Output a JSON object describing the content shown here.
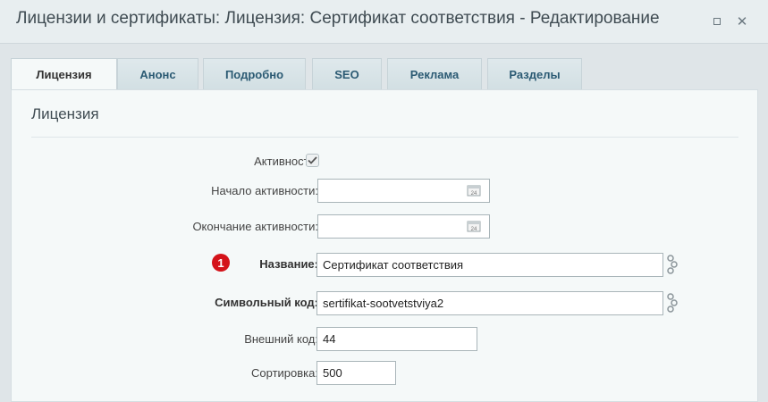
{
  "window": {
    "title": "Лицензии и сертификаты: Лицензия: Сертификат соответствия - Редактирование",
    "minimize_icon": "minimize-icon",
    "close_icon": "close-icon"
  },
  "tabs": [
    {
      "label": "Лицензия",
      "active": true
    },
    {
      "label": "Анонс",
      "active": false
    },
    {
      "label": "Подробно",
      "active": false
    },
    {
      "label": "SEO",
      "active": false
    },
    {
      "label": "Реклама",
      "active": false
    },
    {
      "label": "Разделы",
      "active": false
    }
  ],
  "section": {
    "title": "Лицензия"
  },
  "form": {
    "active": {
      "label": "Активность:",
      "checked": true
    },
    "active_from": {
      "label": "Начало активности:",
      "value": "",
      "icon": "calendar-icon",
      "icon_text": "24"
    },
    "active_to": {
      "label": "Окончание активности:",
      "value": "",
      "icon": "calendar-icon",
      "icon_text": "24"
    },
    "name": {
      "label": "Название:",
      "value": "Сертификат соответствия",
      "badge": "1",
      "required": true
    },
    "code": {
      "label": "Символьный код:",
      "value": "sertifikat-sootvetstviya2",
      "required": true
    },
    "external_code": {
      "label": "Внешний код:",
      "value": "44"
    },
    "sort": {
      "label": "Сортировка:",
      "value": "500"
    }
  },
  "colors": {
    "badge": "#d4131a",
    "tab_text": "#2b5a73",
    "background": "#dfe5e8"
  }
}
